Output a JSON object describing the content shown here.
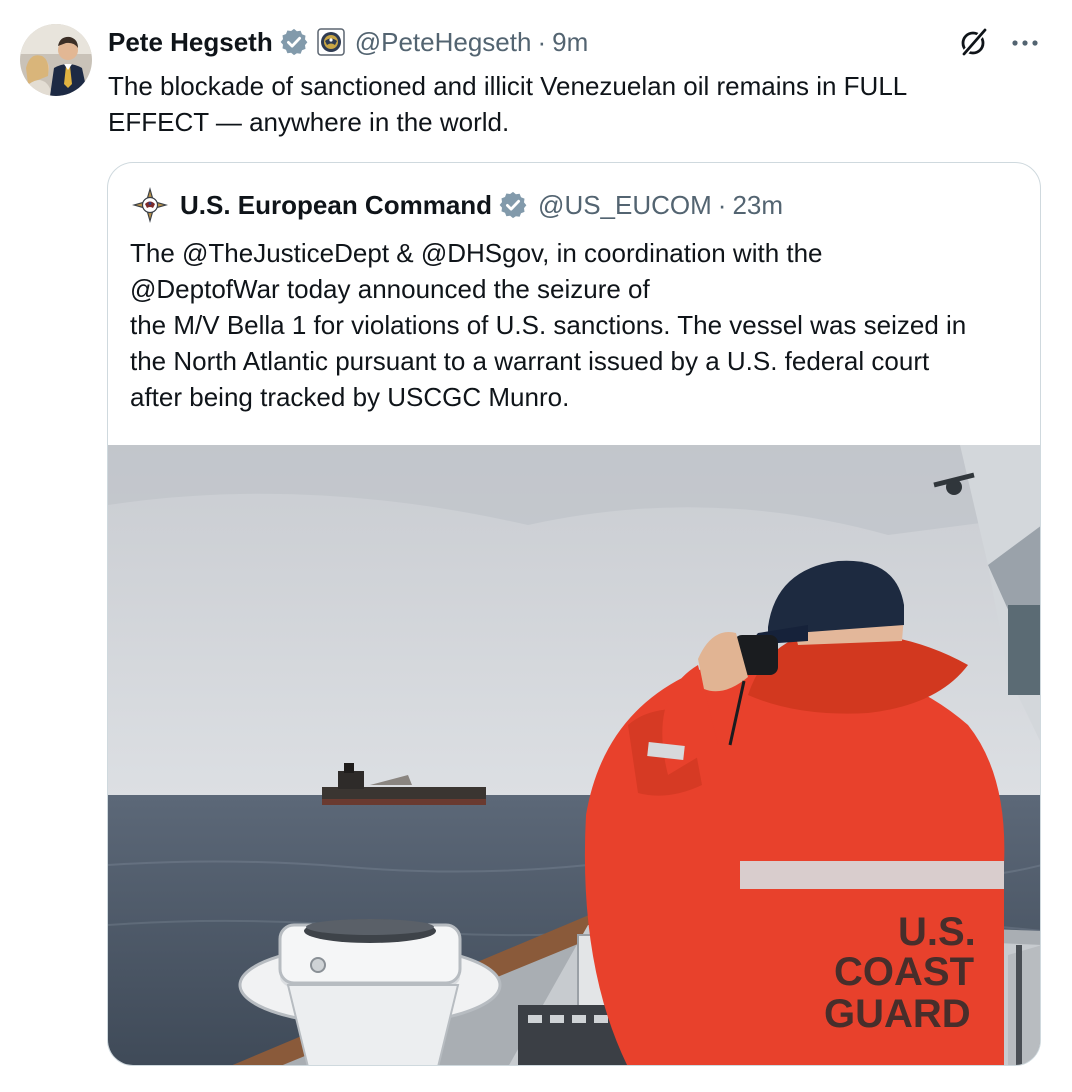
{
  "tweet": {
    "author": {
      "display_name": "Pete Hegseth",
      "handle": "@PeteHegseth",
      "time": "9m",
      "verified_icon": "verified-badge-icon",
      "affiliation_icon": "government-seal-icon"
    },
    "text_lines": [
      "The blockade of sanctioned and illicit Venezuelan oil remains in FULL",
      "EFFECT — anywhere in the world."
    ],
    "separator": "·",
    "actions": {
      "grok_icon": "grok-icon",
      "more_icon": "more-options-icon"
    }
  },
  "quote": {
    "author": {
      "display_name": "U.S. European Command",
      "handle": "@US_EUCOM",
      "time": "23m"
    },
    "text_lines": [
      "The @TheJusticeDept & @DHSgov, in coordination with the",
      "@DeptofWar today announced the seizure of",
      "the M/V Bella 1 for violations of U.S. sanctions. The vessel was seized in",
      "the North Atlantic pursuant to a warrant issued by a U.S. federal court",
      "after being tracked by USCGC Munro."
    ],
    "media": {
      "jacket_lines": [
        "U.S.",
        "COAST",
        "GUARD"
      ]
    }
  },
  "colors": {
    "text": "#0f1419",
    "secondary": "#536471",
    "verified": "#829aab",
    "border": "#cfd9de",
    "jacket": "#e8412c"
  }
}
